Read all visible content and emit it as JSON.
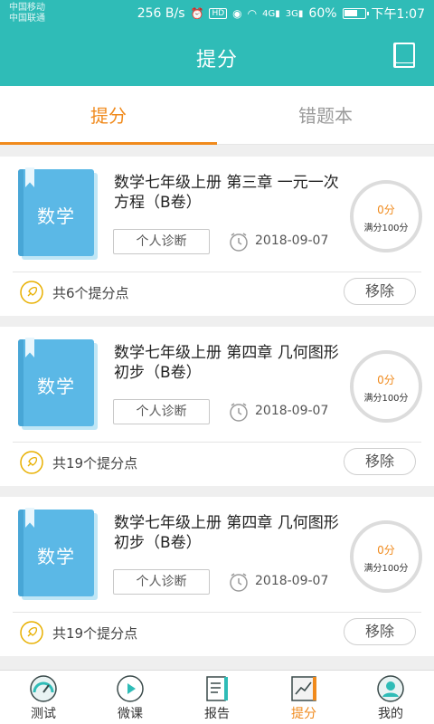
{
  "status_bar": {
    "carrier1": "中国移动",
    "carrier2": "中国联通",
    "speed": "256 B/s",
    "signal1": "4G",
    "signal2": "3G",
    "battery": "60%",
    "time": "下午1:07"
  },
  "header": {
    "title": "提分"
  },
  "tabs": [
    {
      "label": "提分",
      "active": true
    },
    {
      "label": "错题本",
      "active": false
    }
  ],
  "cards": [
    {
      "book_label": "数学",
      "title": "数学七年级上册 第三章 一元一次方程（B卷）",
      "diagnose_label": "个人诊断",
      "date": "2018-09-07",
      "score": "0分",
      "full_score": "满分100分",
      "points": "共6个提分点",
      "remove_label": "移除"
    },
    {
      "book_label": "数学",
      "title": "数学七年级上册 第四章 几何图形初步（B卷）",
      "diagnose_label": "个人诊断",
      "date": "2018-09-07",
      "score": "0分",
      "full_score": "满分100分",
      "points": "共19个提分点",
      "remove_label": "移除"
    },
    {
      "book_label": "数学",
      "title": "数学七年级上册 第四章 几何图形初步（B卷）",
      "diagnose_label": "个人诊断",
      "date": "2018-09-07",
      "score": "0分",
      "full_score": "满分100分",
      "points": "共19个提分点",
      "remove_label": "移除"
    }
  ],
  "bottom_nav": [
    {
      "label": "测试",
      "icon": "test-gauge-icon"
    },
    {
      "label": "微课",
      "icon": "play-icon"
    },
    {
      "label": "报告",
      "icon": "report-icon"
    },
    {
      "label": "提分",
      "icon": "trend-chart-icon",
      "active": true
    },
    {
      "label": "我的",
      "icon": "user-avatar-icon"
    }
  ],
  "colors": {
    "header_bg": "#2fbcb7",
    "accent": "#f08a1c",
    "book_cover": "#5bb8e6"
  }
}
